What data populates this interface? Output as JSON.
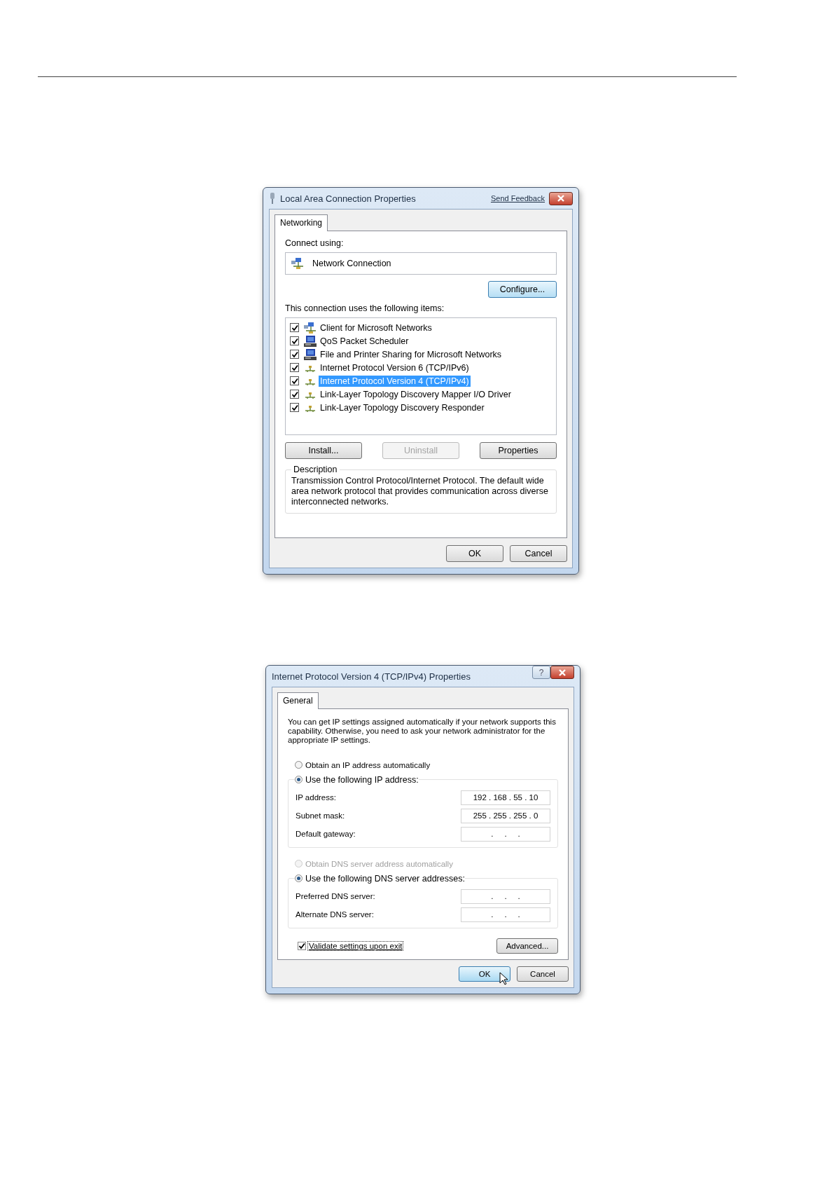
{
  "lan_dialog": {
    "title": "Local Area Connection Properties",
    "feedback_link": "Send Feedback",
    "tabs": [
      {
        "label": "Networking",
        "selected": true
      }
    ],
    "connect_label": "Connect using:",
    "adapter": "Network Connection",
    "configure_button": "Configure...",
    "items_label": "This connection uses the following items:",
    "items": [
      {
        "label": "Client for Microsoft Networks",
        "kind": "client",
        "checked": true,
        "selected": false
      },
      {
        "label": "QoS Packet Scheduler",
        "kind": "service",
        "checked": true,
        "selected": false
      },
      {
        "label": "File and Printer Sharing for Microsoft Networks",
        "kind": "service",
        "checked": true,
        "selected": false
      },
      {
        "label": "Internet Protocol Version 6 (TCP/IPv6)",
        "kind": "protocol",
        "checked": true,
        "selected": false
      },
      {
        "label": "Internet Protocol Version 4 (TCP/IPv4)",
        "kind": "protocol",
        "checked": true,
        "selected": true
      },
      {
        "label": "Link-Layer Topology Discovery Mapper I/O Driver",
        "kind": "protocol",
        "checked": true,
        "selected": false
      },
      {
        "label": "Link-Layer Topology Discovery Responder",
        "kind": "protocol",
        "checked": true,
        "selected": false
      }
    ],
    "item_buttons": [
      {
        "label": "Install...",
        "disabled": false
      },
      {
        "label": "Uninstall",
        "disabled": true
      },
      {
        "label": "Properties",
        "disabled": false
      }
    ],
    "description_title": "Description",
    "description": "Transmission Control Protocol/Internet Protocol. The default wide area network protocol that provides communication across diverse interconnected networks.",
    "footer_buttons": [
      {
        "label": "OK",
        "default": false
      },
      {
        "label": "Cancel",
        "default": false
      }
    ]
  },
  "ipv4_dialog": {
    "title": "Internet Protocol Version 4 (TCP/IPv4) Properties",
    "help_button": "?",
    "tabs": [
      {
        "label": "General",
        "selected": true
      }
    ],
    "intro": "You can get IP settings assigned automatically if your network supports this capability. Otherwise, you need to ask your network administrator for the appropriate IP settings.",
    "ip_auto": {
      "label": "Obtain an IP address automatically",
      "selected": false,
      "disabled": false
    },
    "ip_manual": {
      "label": "Use the following IP address:",
      "selected": true,
      "disabled": false
    },
    "ip_fields": [
      {
        "label": "IP address:",
        "value": "192 . 168 . 55 . 10"
      },
      {
        "label": "Subnet mask:",
        "value": "255 . 255 . 255 . 0"
      },
      {
        "label": "Default gateway:",
        "value": ".     .     ."
      }
    ],
    "dns_auto": {
      "label": "Obtain DNS server address automatically",
      "selected": false,
      "disabled": true
    },
    "dns_manual": {
      "label": "Use the following DNS server addresses:",
      "selected": true,
      "disabled": false
    },
    "dns_fields": [
      {
        "label": "Preferred DNS server:",
        "value": ".     .     ."
      },
      {
        "label": "Alternate DNS server:",
        "value": ".     .     ."
      }
    ],
    "validate": {
      "label": "Validate settings upon exit",
      "checked": true
    },
    "advanced_button": "Advanced...",
    "footer_buttons": [
      {
        "label": "OK",
        "default": true
      },
      {
        "label": "Cancel",
        "default": false
      }
    ]
  }
}
